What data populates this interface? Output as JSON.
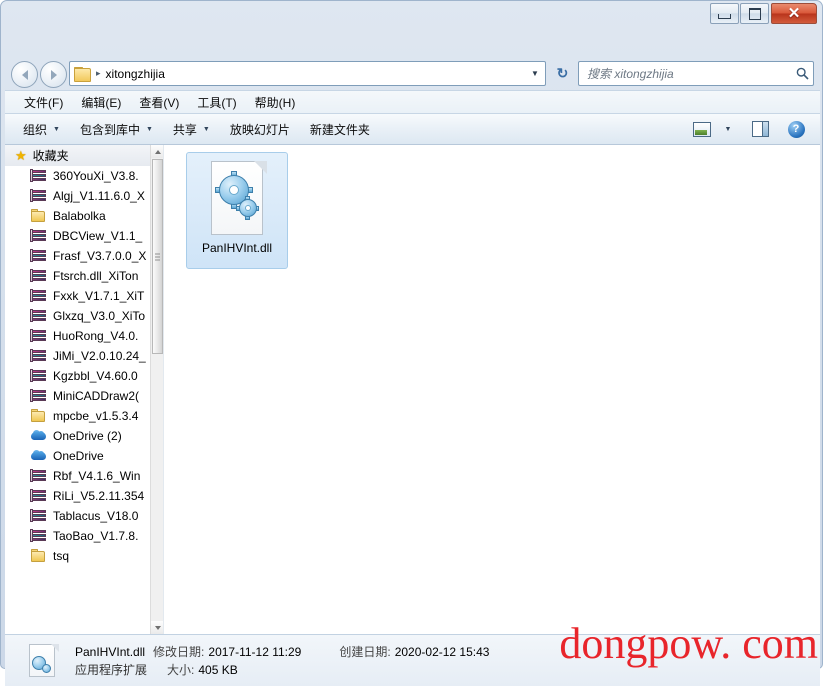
{
  "window": {
    "title": "",
    "buttons": {
      "minimize": "–",
      "maximize": "❐",
      "close": "✕"
    }
  },
  "address": {
    "path_crumb": "xitongzhijia",
    "separator": "▸",
    "dropdown": "▼",
    "refresh": "↻"
  },
  "search": {
    "placeholder": "搜索 xitongzhijia",
    "value": ""
  },
  "menubar": {
    "items": [
      {
        "label": "文件(F)"
      },
      {
        "label": "编辑(E)"
      },
      {
        "label": "查看(V)"
      },
      {
        "label": "工具(T)"
      },
      {
        "label": "帮助(H)"
      }
    ]
  },
  "commandbar": {
    "items": [
      {
        "label": "组织",
        "caret": "▼"
      },
      {
        "label": "包含到库中",
        "caret": "▼"
      },
      {
        "label": "共享",
        "caret": "▼"
      },
      {
        "label": "放映幻灯片",
        "caret": ""
      },
      {
        "label": "新建文件夹",
        "caret": ""
      }
    ],
    "view_caret": "▼",
    "help_label": "?"
  },
  "navpane": {
    "header": {
      "label": "收藏夹",
      "icon": "star-icon"
    },
    "items": [
      {
        "label": "360YouXi_V3.8.",
        "icon": "archive-icon"
      },
      {
        "label": "Algj_V1.11.6.0_X",
        "icon": "archive-icon"
      },
      {
        "label": "Balabolka",
        "icon": "folder-icon"
      },
      {
        "label": "DBCView_V1.1_",
        "icon": "archive-icon"
      },
      {
        "label": "Frasf_V3.7.0.0_X",
        "icon": "archive-icon"
      },
      {
        "label": "Ftsrch.dll_XiTon",
        "icon": "archive-icon"
      },
      {
        "label": "Fxxk_V1.7.1_XiT",
        "icon": "archive-icon"
      },
      {
        "label": "Glxzq_V3.0_XiTo",
        "icon": "archive-icon"
      },
      {
        "label": "HuoRong_V4.0.",
        "icon": "archive-icon"
      },
      {
        "label": "JiMi_V2.0.10.24_",
        "icon": "archive-icon"
      },
      {
        "label": "Kgzbbl_V4.60.0",
        "icon": "archive-icon"
      },
      {
        "label": "MiniCADDraw2(",
        "icon": "archive-icon"
      },
      {
        "label": "mpcbe_v1.5.3.4",
        "icon": "folder-icon"
      },
      {
        "label": "OneDrive (2)",
        "icon": "cloud-icon"
      },
      {
        "label": "OneDrive",
        "icon": "cloud-icon"
      },
      {
        "label": "Rbf_V4.1.6_Win",
        "icon": "archive-icon"
      },
      {
        "label": "RiLi_V5.2.11.354",
        "icon": "archive-icon"
      },
      {
        "label": "Tablacus_V18.0",
        "icon": "archive-icon"
      },
      {
        "label": "TaoBao_V1.7.8.",
        "icon": "archive-icon"
      },
      {
        "label": "tsq",
        "icon": "folder-icon"
      }
    ]
  },
  "content": {
    "files": [
      {
        "name": "PanIHVInt.dll",
        "icon": "dll-file-icon",
        "selected": true
      }
    ]
  },
  "status": {
    "file_name": "PanIHVInt.dll",
    "modified_label": "修改日期:",
    "modified_value": "2017-11-12 11:29",
    "created_label": "创建日期:",
    "created_value": "2020-02-12 15:43",
    "type_value": "应用程序扩展",
    "size_label": "大小:",
    "size_value": "405 KB"
  },
  "watermark": {
    "text": "dongpow. com",
    "color": "#e8252b"
  }
}
